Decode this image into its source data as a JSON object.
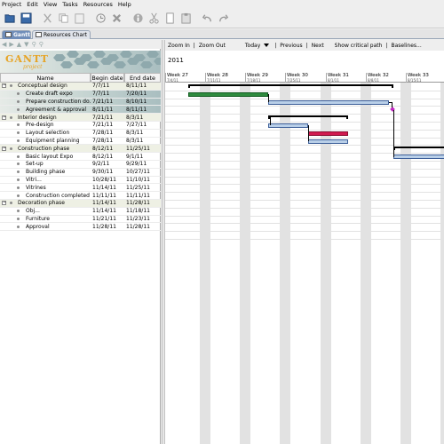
{
  "menu": [
    "Project",
    "Edit",
    "View",
    "Tasks",
    "Resources",
    "Help"
  ],
  "toolbar_icons": [
    "open-folder-icon",
    "save-icon",
    "cut-icon",
    "copy-icon",
    "paste-icon",
    "history-icon",
    "delete-icon",
    "info-icon",
    "scissors-icon",
    "document-icon",
    "clipboard-icon",
    "undo-icon",
    "redo-icon"
  ],
  "tabs": [
    {
      "label": "Gantt",
      "active": true
    },
    {
      "label": "Resources Chart",
      "active": false
    }
  ],
  "logo": {
    "title": "GANTT",
    "subtitle": "project"
  },
  "columns": {
    "name": "Name",
    "begin": "Begin date",
    "end": "End date"
  },
  "rows": [
    {
      "name": "Conceptual design",
      "begin": "7/7/11",
      "end": "8/11/11",
      "level": 0,
      "group": true
    },
    {
      "name": "Create draft expo",
      "begin": "7/7/11",
      "end": "7/20/11",
      "level": 1,
      "group": false
    },
    {
      "name": "Prepare construction do...",
      "begin": "7/21/11",
      "end": "8/10/11",
      "level": 1,
      "group": false
    },
    {
      "name": "Agreement & approval",
      "begin": "8/11/11",
      "end": "8/11/11",
      "level": 1,
      "group": false
    },
    {
      "name": "Interior design",
      "begin": "7/21/11",
      "end": "8/3/11",
      "level": 0,
      "group": true
    },
    {
      "name": "Pre-design",
      "begin": "7/21/11",
      "end": "7/27/11",
      "level": 1,
      "group": false
    },
    {
      "name": "Layout selection",
      "begin": "7/28/11",
      "end": "8/3/11",
      "level": 1,
      "group": false
    },
    {
      "name": "Equipment planning",
      "begin": "7/28/11",
      "end": "8/3/11",
      "level": 1,
      "group": false
    },
    {
      "name": "Construction phase",
      "begin": "8/12/11",
      "end": "11/25/11",
      "level": 0,
      "group": true
    },
    {
      "name": "Basic layout Expo",
      "begin": "8/12/11",
      "end": "9/1/11",
      "level": 1,
      "group": false
    },
    {
      "name": "Set-up",
      "begin": "9/2/11",
      "end": "9/29/11",
      "level": 1,
      "group": false
    },
    {
      "name": "Building phase",
      "begin": "9/30/11",
      "end": "10/27/11",
      "level": 1,
      "group": false
    },
    {
      "name": "Vitri...",
      "begin": "10/28/11",
      "end": "11/10/11",
      "level": 1,
      "group": false
    },
    {
      "name": "Vitrines",
      "begin": "11/14/11",
      "end": "11/25/11",
      "level": 1,
      "group": false
    },
    {
      "name": "Construction completed",
      "begin": "11/11/11",
      "end": "11/11/11",
      "level": 1,
      "group": false
    },
    {
      "name": "Decoration phase",
      "begin": "11/14/11",
      "end": "11/28/11",
      "level": 0,
      "group": true
    },
    {
      "name": "Obj...",
      "begin": "11/14/11",
      "end": "11/18/11",
      "level": 1,
      "group": false
    },
    {
      "name": "Furniture",
      "begin": "11/21/11",
      "end": "11/23/11",
      "level": 1,
      "group": false
    },
    {
      "name": "Approval",
      "begin": "11/28/11",
      "end": "11/28/11",
      "level": 1,
      "group": false
    }
  ],
  "chart_toolbar": {
    "zoom_in": "Zoom In",
    "sep1": "|",
    "zoom_out": "Zoom Out",
    "today": "Today",
    "sep2": "|",
    "previous": "Previous",
    "sep3": "|",
    "next": "Next",
    "critical": "Show critical path",
    "sep4": "|",
    "baselines": "Baselines..."
  },
  "year": "2011",
  "weeks": [
    {
      "label": "Week 27",
      "date": "7/4/11"
    },
    {
      "label": "Week 28",
      "date": "7/11/11"
    },
    {
      "label": "Week 29",
      "date": "7/18/11"
    },
    {
      "label": "Week 30",
      "date": "7/25/11"
    },
    {
      "label": "Week 31",
      "date": "8/1/11"
    },
    {
      "label": "Week 32",
      "date": "8/8/11"
    },
    {
      "label": "Week 33",
      "date": "8/15/11"
    }
  ],
  "colors": {
    "tab_active": "#6f8db9",
    "task_fill": "#b9cfe8",
    "task_border": "#3d5f99",
    "critical_green": "#2e8b3e",
    "critical_red": "#d11a4f",
    "milestone": "#c32ac3",
    "logo_orange": "#e7a426"
  }
}
